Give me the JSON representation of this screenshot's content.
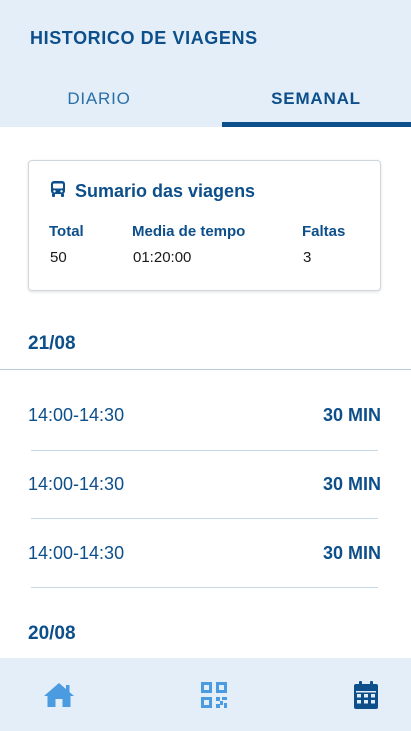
{
  "header": {
    "title": "HISTORICO DE VIAGENS",
    "tabs": [
      {
        "label": "DIARIO",
        "active": false
      },
      {
        "label": "SEMANAL",
        "active": true
      }
    ]
  },
  "summary": {
    "icon": "bus-icon",
    "title": "Sumario das viagens",
    "columns": [
      {
        "label": "Total",
        "value": "50"
      },
      {
        "label": "Media de tempo",
        "value": "01:20:00"
      },
      {
        "label": "Faltas",
        "value": "3"
      }
    ]
  },
  "history": [
    {
      "date": "21/08",
      "trips": [
        {
          "time": "14:00-14:30",
          "duration": "30 MIN"
        },
        {
          "time": "14:00-14:30",
          "duration": "30 MIN"
        },
        {
          "time": "14:00-14:30",
          "duration": "30 MIN"
        }
      ]
    },
    {
      "date": "20/08",
      "trips": []
    }
  ],
  "bottom_nav": {
    "items": [
      {
        "icon": "home-icon",
        "active": false
      },
      {
        "icon": "qr-code-icon",
        "active": false
      },
      {
        "icon": "calendar-icon",
        "active": true
      }
    ]
  },
  "colors": {
    "primary": "#0d4f8b",
    "header_bg": "#e3eef8",
    "inactive_icon": "#4a9be0"
  }
}
